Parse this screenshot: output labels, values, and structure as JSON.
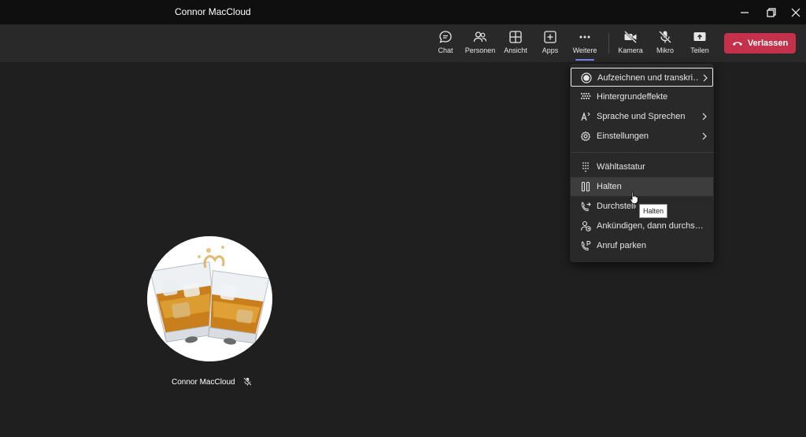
{
  "window": {
    "title": "Connor MacCloud"
  },
  "toolbar": {
    "chat": "Chat",
    "people": "Personen",
    "view": "Ansicht",
    "apps": "Apps",
    "more": "Weitere",
    "camera": "Kamera",
    "mic": "Mikro",
    "share": "Teilen",
    "leave": "Verlassen"
  },
  "menu": {
    "items": [
      {
        "label": "Aufzeichnen und transkri…",
        "icon": "record-icon",
        "submenu": true
      },
      {
        "label": "Hintergrundeffekte",
        "icon": "background-effects-icon",
        "submenu": false
      },
      {
        "label": "Sprache und Sprechen",
        "icon": "language-icon",
        "submenu": true
      },
      {
        "label": "Einstellungen",
        "icon": "settings-icon",
        "submenu": true
      },
      {
        "label": "Wähltastatur",
        "icon": "dialpad-icon",
        "submenu": false
      },
      {
        "label": "Halten",
        "icon": "pause-icon",
        "submenu": false
      },
      {
        "label": "Durchstellen",
        "icon": "transfer-icon",
        "submenu": false
      },
      {
        "label": "Ankündigen, dann durchs…",
        "icon": "consult-transfer-icon",
        "submenu": false
      },
      {
        "label": "Anruf parken",
        "icon": "park-call-icon",
        "submenu": false
      }
    ]
  },
  "tooltip": {
    "text": "Halten"
  },
  "participant": {
    "name": "Connor MacCloud",
    "muted": true
  },
  "colors": {
    "leave": "#c4314b",
    "accent": "#7f85f5",
    "background": "#1f1f1f"
  }
}
